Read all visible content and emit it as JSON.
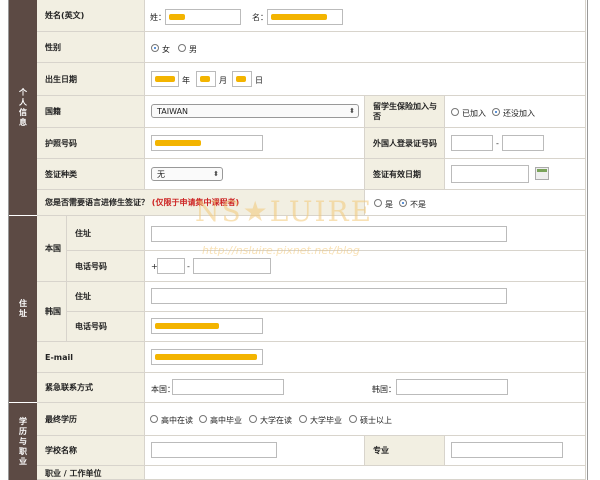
{
  "sections": {
    "personal": "个人信息",
    "address": "住址",
    "education": "学历与职业"
  },
  "name_en": {
    "label": "姓名(英文)",
    "surname_label": "姓：",
    "given_label": "名："
  },
  "gender": {
    "label": "性别",
    "female": "女",
    "male": "男"
  },
  "birth": {
    "label": "出生日期",
    "year": "年",
    "month": "月",
    "day": "日"
  },
  "nationality": {
    "label": "国籍",
    "value": "TAIWAN"
  },
  "insurance": {
    "label": "留学生保险加入与否",
    "joined": "已加入",
    "not_joined": "还没加入"
  },
  "passport": {
    "label": "护照号码"
  },
  "alien_reg": {
    "label": "外国人登录证号码",
    "sep": "-"
  },
  "visa_type": {
    "label": "签证种类",
    "value": "无"
  },
  "visa_expiry": {
    "label": "签证有效日期"
  },
  "visa_change": {
    "question": "您是否需要语言进修生签证？",
    "note": "(仅限于申请集中课程者)",
    "yes": "是",
    "no": "不是"
  },
  "home": {
    "label": "本国",
    "addr_label": "住址",
    "phone_label": "电话号码",
    "plus": "+",
    "dash": "-"
  },
  "korea": {
    "label": "韩国",
    "addr_label": "住址",
    "phone_label": "电话号码"
  },
  "email": {
    "label": "E-mail"
  },
  "emergency": {
    "label": "紧急联系方式",
    "home": "本国：",
    "korea": "韩国："
  },
  "edu": {
    "label": "最终学历",
    "options": [
      "高中在读",
      "高中毕业",
      "大学在读",
      "大学毕业",
      "硕士以上"
    ]
  },
  "school": {
    "label": "学校名称",
    "major": "专业"
  },
  "job": {
    "label": "职业 / 工作单位"
  },
  "watermark": {
    "main": "NS★LUIRE",
    "url": "http://nsluire.pixnet.net/blog"
  },
  "colors": {
    "section_bg": "#5c4a44",
    "label_bg": "#f2efe2",
    "blur": "#f3b400"
  }
}
